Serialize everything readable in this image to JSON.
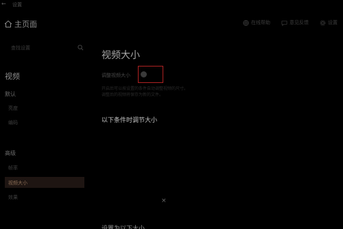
{
  "window": {
    "title": "设置"
  },
  "home": {
    "label": "主页面"
  },
  "header": {
    "actions": [
      {
        "label": "在线帮助",
        "icon": "globe-icon"
      },
      {
        "label": "意见反馈",
        "icon": "chat-icon"
      },
      {
        "label": "设置",
        "icon": "gear-icon"
      }
    ]
  },
  "sidebar": {
    "search_placeholder": "查找设置",
    "section_title": "视频",
    "groups": [
      {
        "label": "默认",
        "items": [
          "亮度",
          "编码"
        ]
      },
      {
        "label": "高级",
        "items": [
          "帧率",
          "视频大小",
          "效果"
        ]
      }
    ],
    "active_item": "视频大小"
  },
  "main": {
    "title": "视频大小",
    "toggle_label": "调整视频大小",
    "toggle_on": false,
    "description_lines": [
      "开启后可以按设置的条件自动调整视频的尺寸。",
      "调整后的视频将保存为新的文件。"
    ],
    "conditions_heading": "以下条件时调节大小",
    "close_symbol": "×",
    "target_heading": "设置为以下大小"
  },
  "colors": {
    "accent_border": "#b02222",
    "active_bg": "#1e1512",
    "active_text": "#8b6d55"
  }
}
